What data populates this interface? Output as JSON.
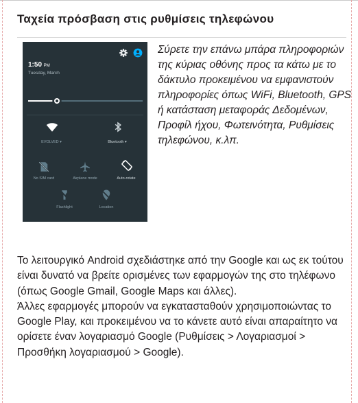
{
  "heading": "Ταχεία πρόσβαση στις ρυθμίσεις τηλεφώνου",
  "screenshot": {
    "time": "1:50",
    "time_suffix": "PM",
    "date": "Tuesday, March",
    "wifi_label": "EVOLVED",
    "bluetooth_label": "Bluetooth",
    "tiles": [
      "No SIM card",
      "Airplane mode",
      "Auto-rotate",
      "Flashlight",
      "Location"
    ],
    "colors": {
      "background": "#263238",
      "accent": "#00b0ff"
    },
    "icons": [
      "gear-icon",
      "account-icon",
      "brightness-icon",
      "wifi-icon",
      "bluetooth-icon",
      "no-sim-icon",
      "airplane-icon",
      "auto-rotate-icon",
      "flashlight-icon",
      "location-icon"
    ]
  },
  "description": "Σύρετε την επάνω μπάρα πληροφοριών της κύριας οθόνης προς τα κάτω με το δάκτυλο προκειμένου να εμφανιστούν πληροφορίες όπως WiFi, Bluetooth, GPS ή κατάσταση μεταφοράς Δεδομένων, Προφίλ ήχου, Φωτεινότητα, Ρυθμίσεις τηλεφώνου, κ.λπ.",
  "paragraph_1": "Το λειτουργικό Android σχεδιάστηκε από την Google και ως εκ τούτου είναι δυνατό να βρείτε ορισμένες των εφαρμογών της στο τηλέφωνο (όπως Google Gmail, Google Maps και άλλες).",
  "paragraph_2": "Άλλες εφαρμογές μπορούν να εγκατασταθούν χρησιμοποιώντας το Google Play, και προκειμένου να το κάνετε αυτό είναι απαραίτητο να ορίσετε έναν λογαριασμό Google (Ρυθμίσεις > Λογαριασμοί > Προσθήκη λογαριασμού > Google)."
}
